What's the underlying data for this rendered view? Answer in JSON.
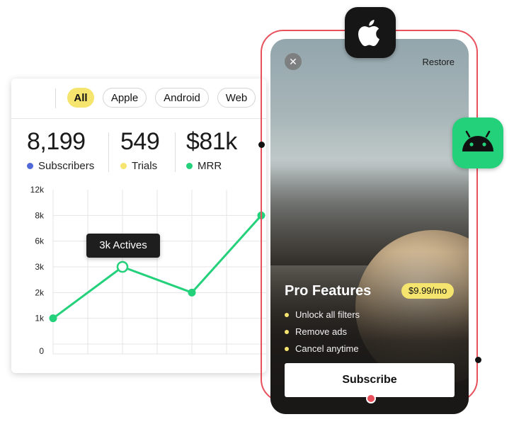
{
  "filters": [
    {
      "label": "All",
      "active": true
    },
    {
      "label": "Apple",
      "active": false
    },
    {
      "label": "Android",
      "active": false
    },
    {
      "label": "Web",
      "active": false
    }
  ],
  "stats": [
    {
      "value": "8,199",
      "label": "Subscribers",
      "color": "#5068d8"
    },
    {
      "value": "549",
      "label": "Trials",
      "color": "#f5e56e"
    },
    {
      "value": "$81k",
      "label": "MRR",
      "color": "#24d17b"
    }
  ],
  "chart_data": {
    "type": "line",
    "y_tick_labels": [
      "12k",
      "8k",
      "6k",
      "3k",
      "2k",
      "1k",
      "0"
    ],
    "points": [
      {
        "x": 1,
        "tick": "1k"
      },
      {
        "x": 3,
        "tick": "3k"
      },
      {
        "x": 5,
        "tick": "2k"
      },
      {
        "x": 7,
        "tick": "8k"
      }
    ],
    "highlight_index": 1,
    "tooltip": "3k Actives",
    "line_color": "#24d17b",
    "grid": true
  },
  "paywall": {
    "restore_label": "Restore",
    "title": "Pro Features",
    "price": "$9.99/mo",
    "features": [
      "Unlock all filters",
      "Remove ads",
      "Cancel anytime"
    ],
    "cta_label": "Subscribe",
    "accent": "#f5e56e",
    "outline_color": "#e8505b"
  },
  "badges": {
    "apple_icon": "apple-icon",
    "android_icon": "android-icon"
  }
}
